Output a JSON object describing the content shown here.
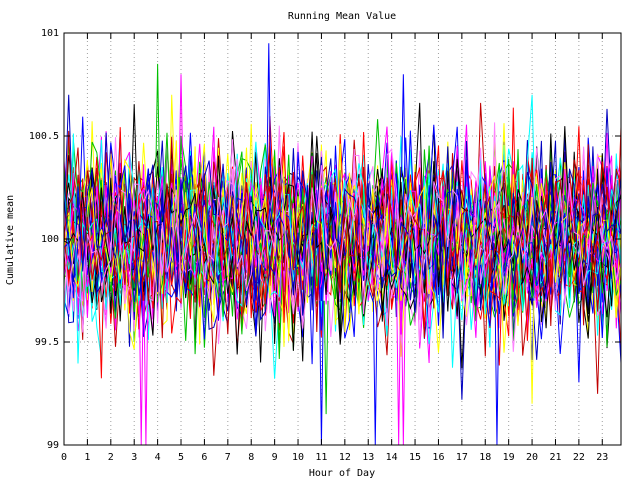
{
  "chart_data": {
    "type": "line",
    "title": "Running Mean Value",
    "xlabel": "Hour of Day",
    "ylabel": "Cumulative mean",
    "xlim": [
      0,
      23.8
    ],
    "ylim": [
      99,
      101
    ],
    "x_ticks": [
      0,
      1,
      2,
      3,
      4,
      5,
      6,
      7,
      8,
      9,
      10,
      11,
      12,
      13,
      14,
      15,
      16,
      17,
      18,
      19,
      20,
      21,
      22,
      23
    ],
    "x_tick_labels": [
      "0",
      "1",
      "2",
      "3",
      "4",
      "5",
      "6",
      "7",
      "8",
      "9",
      "10",
      "11",
      "12",
      "13",
      "14",
      "15",
      "16",
      "17",
      "18",
      "19",
      "20",
      "21",
      "22",
      "23"
    ],
    "y_ticks": [
      99,
      99.5,
      100,
      100.5,
      101
    ],
    "y_tick_labels": [
      "99",
      "99.5",
      "100",
      "100.5",
      "101"
    ],
    "grid": "dotted",
    "legend": "none",
    "series_count": 60,
    "samples_per_series": 120,
    "center_value": 100,
    "spread_sd": 0.2,
    "series_colors": [
      "#ff0000",
      "#00c000",
      "#0000ff",
      "#ff00ff",
      "#00ffff",
      "#ffff00",
      "#000000",
      "#c00000",
      "#0000c0",
      "#ff80ff"
    ],
    "notable_spikes": [
      {
        "x": 3.3,
        "y": 99.0,
        "color": "#ff00ff"
      },
      {
        "x": 3.5,
        "y": 99.0,
        "color": "#ff00ff"
      },
      {
        "x": 8.75,
        "y": 100.95,
        "color": "#0000ff"
      },
      {
        "x": 11.0,
        "y": 99.0,
        "color": "#0000ff"
      },
      {
        "x": 13.3,
        "y": 99.0,
        "color": "#0000ff"
      },
      {
        "x": 14.3,
        "y": 99.0,
        "color": "#ff00ff"
      },
      {
        "x": 14.5,
        "y": 99.0,
        "color": "#ff00ff"
      },
      {
        "x": 14.5,
        "y": 100.8,
        "color": "#0000ff"
      },
      {
        "x": 18.5,
        "y": 99.0,
        "color": "#0000ff"
      },
      {
        "x": 4.0,
        "y": 100.85,
        "color": "#00c000"
      },
      {
        "x": 5.0,
        "y": 100.8,
        "color": "#ff00ff"
      },
      {
        "x": 20.0,
        "y": 99.2,
        "color": "#ffff00"
      },
      {
        "x": 11.2,
        "y": 99.15,
        "color": "#00c000"
      }
    ]
  }
}
